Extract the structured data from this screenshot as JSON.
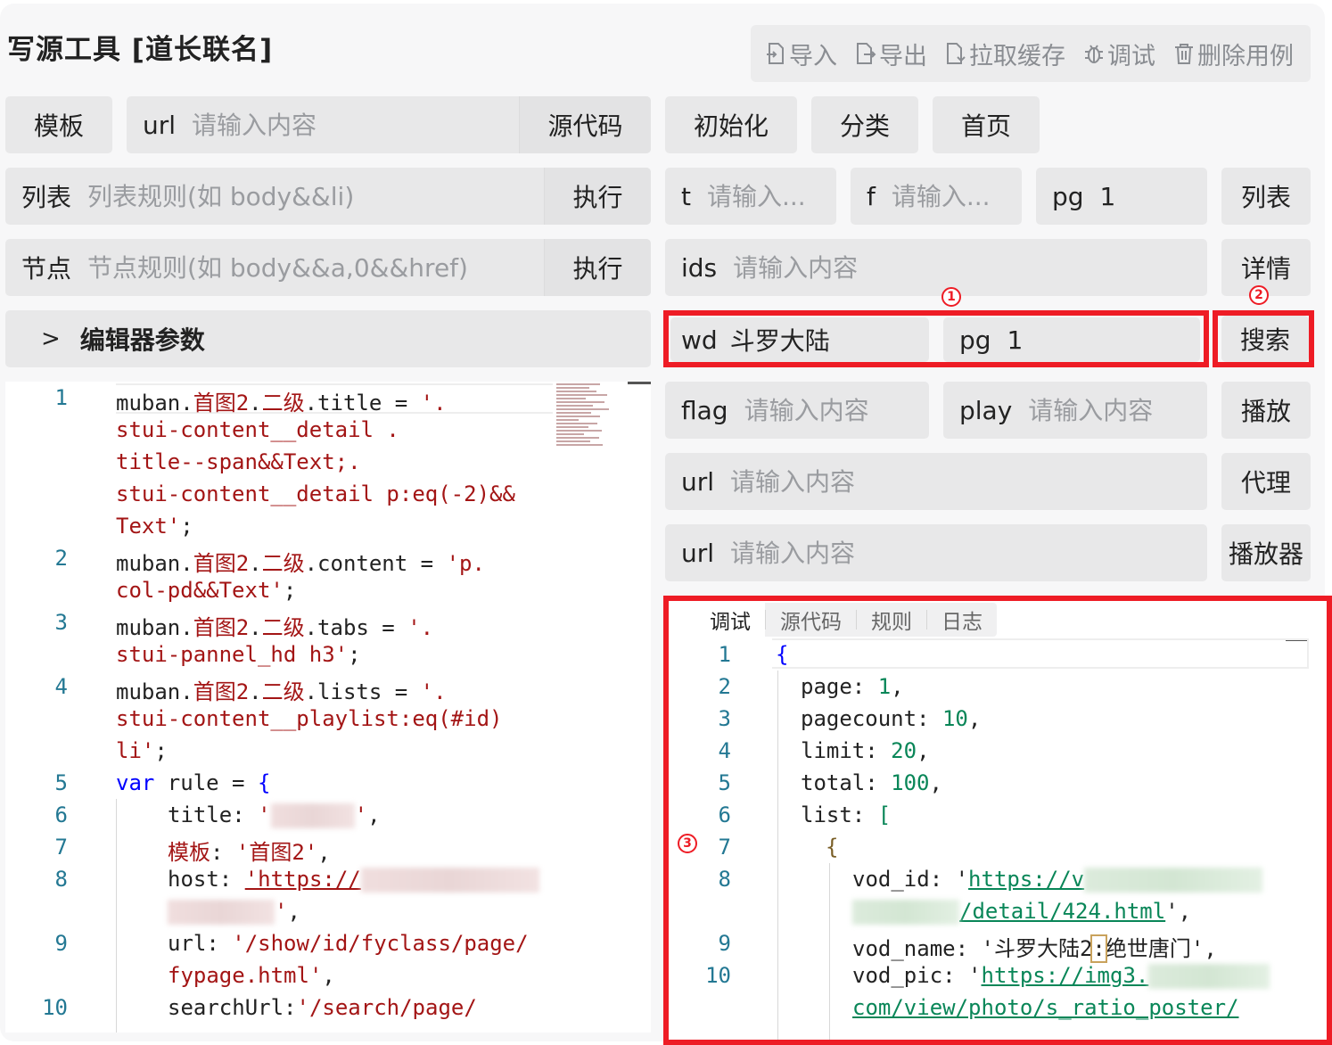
{
  "app": {
    "title": "写源工具 [道长联名]"
  },
  "toolbar": {
    "items": [
      {
        "label": "导入",
        "icon": "import-icon"
      },
      {
        "label": "导出",
        "icon": "export-icon"
      },
      {
        "label": "拉取缓存",
        "icon": "fetch-cache-icon"
      },
      {
        "label": "调试",
        "icon": "bug-icon"
      },
      {
        "label": "删除用例",
        "icon": "trash-icon"
      }
    ]
  },
  "row1": {
    "template_button": "模板",
    "url_label": "url",
    "url_placeholder": "请输入内容",
    "source_button": "源代码",
    "init_button": "初始化",
    "category_button": "分类",
    "home_button": "首页"
  },
  "row2": {
    "list_label": "列表",
    "list_placeholder": "列表规则(如 body&&li)",
    "list_exec": "执行",
    "t_label": "t",
    "t_placeholder": "请输入...",
    "f_label": "f",
    "f_placeholder": "请输入...",
    "pg_label": "pg",
    "pg_value": "1",
    "list_button": "列表"
  },
  "row3": {
    "node_label": "节点",
    "node_placeholder": "节点规则(如 body&&a,0&&href)",
    "node_exec": "执行",
    "ids_label": "ids",
    "ids_placeholder": "请输入内容",
    "detail_button": "详情"
  },
  "row4": {
    "editor_params": "编辑器参数",
    "wd_label": "wd",
    "wd_value": "斗罗大陆",
    "pg_label": "pg",
    "pg_value": "1",
    "search_button": "搜索"
  },
  "row5": {
    "flag_label": "flag",
    "flag_placeholder": "请输入内容",
    "play_label": "play",
    "play_placeholder": "请输入内容",
    "play_button": "播放"
  },
  "row6": {
    "url_label": "url",
    "url_placeholder": "请输入内容",
    "proxy_button": "代理"
  },
  "row7": {
    "url_label": "url",
    "url_placeholder": "请输入内容",
    "player_button": "播放器"
  },
  "annotations": {
    "one": "1",
    "two": "2",
    "three": "3"
  },
  "editor": {
    "line_numbers": [
      "1",
      "2",
      "3",
      "4",
      "5",
      "6",
      "7",
      "8",
      "9",
      "10"
    ],
    "l1_obj": "muban.",
    "l1_a": "首图2",
    "l1_dot": ".",
    "l1_b": "二级",
    "l1_prop": ".title = ",
    "l1_s1": "'.",
    "l1_s2": "stui-content__detail .",
    "l1_s3": "title--span&&Text;.",
    "l1_s4": "stui-content__detail p:eq(-2)&&",
    "l1_s5": "Text'",
    "l1_end": ";",
    "l2_prop": ".content = ",
    "l2_s1": "'p.",
    "l2_s2": "col-pd&&Text'",
    "l2_end": ";",
    "l3_prop": ".tabs = ",
    "l3_s1": "'.",
    "l3_s2": "stui-pannel_hd h3'",
    "l3_end": ";",
    "l4_prop": ".lists = ",
    "l4_s1": "'.",
    "l4_s2": "stui-content__playlist:eq(#id)",
    "l4_s3": "li'",
    "l4_end": ";",
    "l5_kw": "var",
    "l5_rest": " rule = ",
    "l5_brace": "{",
    "l6_key": "title: ",
    "l6_q1": "'",
    "l6_q2": "'",
    "l6_end": ",",
    "l7_key": "模板",
    "l7_colon": ": ",
    "l7_val": "'首图2'",
    "l7_end": ",",
    "l8_key": "host: ",
    "l8_val": "'https://",
    "l8_q": "'",
    "l8_end": ",",
    "l9_key": "url: ",
    "l9_s1": "'/show/id/fyclass/page/",
    "l9_s2": "fypage.html'",
    "l9_end": ",",
    "l10_key": "searchUrl:",
    "l10_val": "'/search/page/"
  },
  "result": {
    "tabs": [
      "调试",
      "源代码",
      "规则",
      "日志"
    ],
    "line_numbers": [
      "1",
      "2",
      "3",
      "4",
      "5",
      "6",
      "7",
      "8",
      "9",
      "10"
    ],
    "open_brace": "{",
    "page_key": "page: ",
    "page_val": "1",
    "pagecount_key": "pagecount: ",
    "pagecount_val": "10",
    "limit_key": "limit: ",
    "limit_val": "20",
    "total_key": "total: ",
    "total_val": "100",
    "list_key": "list: ",
    "list_bracket": "[",
    "item_brace": "{",
    "vod_id_key": "vod_id: ",
    "vod_id_q": "'",
    "vod_id_s1": "https://v",
    "vod_id_s2": "/detail/424.html",
    "vod_id_end": "',",
    "vod_name_key": "vod_name: ",
    "vod_name_val1": "'斗罗大陆2",
    "vod_name_colon": ":",
    "vod_name_val2": "绝世唐门'",
    "vod_name_end": ",",
    "vod_pic_key": "vod_pic: ",
    "vod_pic_q": "'",
    "vod_pic_s1": "https://img3.",
    "vod_pic_s2": "com/view/photo/s_ratio_poster/"
  },
  "colors": {
    "accent_red": "#ee1c25",
    "button_bg": "#e8e8e9",
    "code_string": "#a31515",
    "code_number": "#098658",
    "code_keyword": "#0000ff"
  }
}
